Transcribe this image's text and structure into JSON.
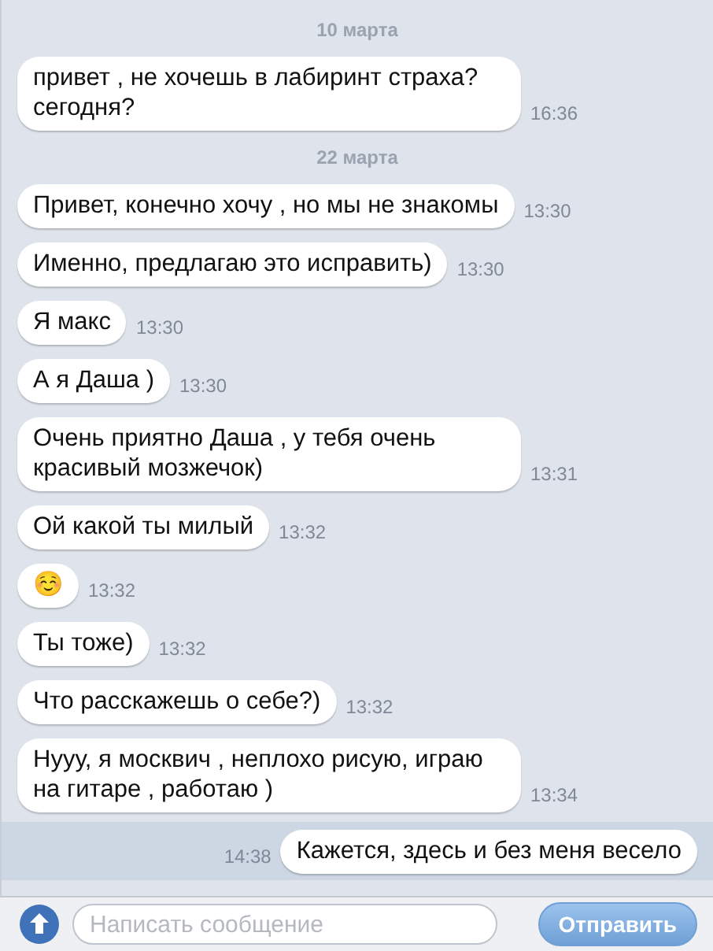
{
  "messages": [
    {
      "kind": "date",
      "text": "10 марта"
    },
    {
      "kind": "incoming",
      "text": "привет , не хочешь в лабиринт страха? сегодня?",
      "time": "16:36",
      "highlighted": false
    },
    {
      "kind": "date",
      "text": "22 марта"
    },
    {
      "kind": "incoming",
      "text": "Привет, конечно хочу , но мы не знакомы",
      "time": "13:30",
      "highlighted": false
    },
    {
      "kind": "incoming",
      "text": "Именно, предлагаю это исправить)",
      "time": "13:30",
      "highlighted": false
    },
    {
      "kind": "incoming",
      "text": "Я макс",
      "time": "13:30",
      "highlighted": false
    },
    {
      "kind": "incoming",
      "text": "А я Даша )",
      "time": "13:30",
      "highlighted": false
    },
    {
      "kind": "incoming",
      "text": "Очень приятно Даша , у тебя очень красивый мозжечок)",
      "time": "13:31",
      "highlighted": false
    },
    {
      "kind": "incoming",
      "text": "Ой какой ты милый",
      "time": "13:32",
      "highlighted": false
    },
    {
      "kind": "incoming",
      "text": "☺️",
      "time": "13:32",
      "highlighted": false
    },
    {
      "kind": "incoming",
      "text": "Ты тоже)",
      "time": "13:32",
      "highlighted": false
    },
    {
      "kind": "incoming",
      "text": "Что расскажешь о себе?)",
      "time": "13:32",
      "highlighted": false
    },
    {
      "kind": "incoming",
      "text": "Нууу, я москвич , неплохо рисую, играю на гитаре , работаю )",
      "time": "13:34",
      "highlighted": false
    },
    {
      "kind": "outgoing",
      "text": "Кажется, здесь и без меня весело",
      "time": "14:38",
      "highlighted": true
    }
  ],
  "composer": {
    "placeholder": "Написать сообщение",
    "send_label": "Отправить"
  }
}
